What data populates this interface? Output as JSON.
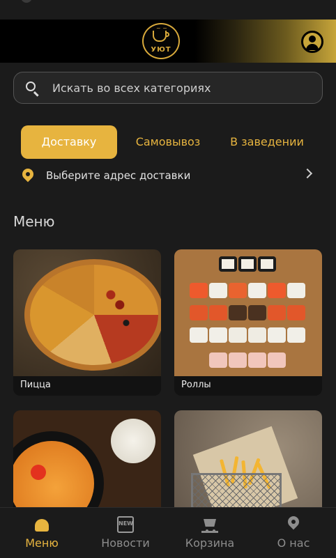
{
  "header": {
    "logo_text": "УЮТ",
    "logo_small": "cafe"
  },
  "search": {
    "placeholder": "Искать во всех категориях"
  },
  "tabs": [
    {
      "label": "Доставку",
      "active": true
    },
    {
      "label": "Самовывоз",
      "active": false
    },
    {
      "label": "В заведении",
      "active": false
    }
  ],
  "address": {
    "label": "Выберите адрес доставки"
  },
  "menu": {
    "title": "Меню",
    "categories": [
      {
        "label": "Пицца"
      },
      {
        "label": "Роллы"
      },
      {
        "label": ""
      },
      {
        "label": ""
      }
    ]
  },
  "bottom_nav": [
    {
      "label": "Меню",
      "icon": "burger-icon",
      "active": true
    },
    {
      "label": "Новости",
      "icon": "new-icon",
      "active": false
    },
    {
      "label": "Корзина",
      "icon": "cart-icon",
      "active": false
    },
    {
      "label": "О нас",
      "icon": "location-icon",
      "active": false
    }
  ],
  "colors": {
    "accent": "#e7b43f",
    "background": "#1b1b1b"
  }
}
